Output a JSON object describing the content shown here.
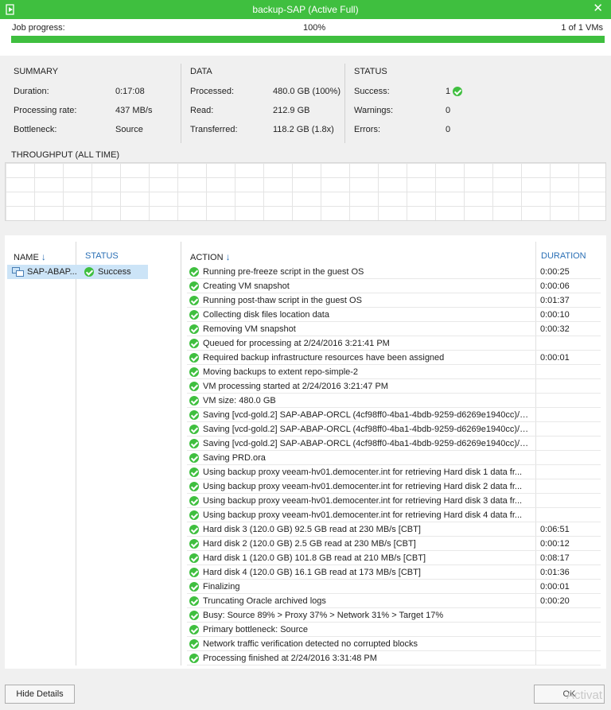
{
  "window": {
    "title": "backup-SAP (Active Full)",
    "close_glyph": "✕"
  },
  "job": {
    "progress_label": "Job progress:",
    "progress_text": "100%",
    "progress_fraction": 1.0,
    "vms_text": "1 of 1 VMs"
  },
  "summary": {
    "heading": "SUMMARY",
    "rows": [
      {
        "label": "Duration:",
        "value": "0:17:08"
      },
      {
        "label": "Processing rate:",
        "value": "437 MB/s"
      },
      {
        "label": "Bottleneck:",
        "value": "Source"
      }
    ]
  },
  "data_section": {
    "heading": "DATA",
    "rows": [
      {
        "label": "Processed:",
        "value": "480.0 GB (100%)"
      },
      {
        "label": "Read:",
        "value": "212.9 GB"
      },
      {
        "label": "Transferred:",
        "value": "118.2 GB (1.8x)"
      }
    ]
  },
  "status_section": {
    "heading": "STATUS",
    "rows": [
      {
        "label": "Success:",
        "value": "1"
      },
      {
        "label": "Warnings:",
        "value": "0"
      },
      {
        "label": "Errors:",
        "value": "0"
      }
    ]
  },
  "throughput": {
    "title": "THROUGHPUT (ALL TIME)"
  },
  "vm_list": {
    "name_header": "NAME",
    "status_header": "STATUS",
    "items": [
      {
        "name": "SAP-ABAP...",
        "status": "Success"
      }
    ]
  },
  "action_list": {
    "action_header": "ACTION",
    "duration_header": "DURATION",
    "rows": [
      {
        "text": "Running pre-freeze script in the guest OS",
        "duration": "0:00:25"
      },
      {
        "text": "Creating VM snapshot",
        "duration": "0:00:06"
      },
      {
        "text": "Running post-thaw script in the guest OS",
        "duration": "0:01:37"
      },
      {
        "text": "Collecting disk files location data",
        "duration": "0:00:10"
      },
      {
        "text": "Removing VM snapshot",
        "duration": "0:00:32"
      },
      {
        "text": "Queued for processing at 2/24/2016 3:21:41 PM",
        "duration": ""
      },
      {
        "text": "Required backup infrastructure resources have been assigned",
        "duration": "0:00:01"
      },
      {
        "text": "Moving backups to extent repo-simple-2",
        "duration": ""
      },
      {
        "text": "VM processing started at 2/24/2016 3:21:47 PM",
        "duration": ""
      },
      {
        "text": "VM size: 480.0 GB",
        "duration": ""
      },
      {
        "text": "Saving [vcd-gold.2] SAP-ABAP-ORCL (4cf98ff0-4ba1-4bdb-9259-d6269e1940cc)/S...",
        "duration": ""
      },
      {
        "text": "Saving [vcd-gold.2] SAP-ABAP-ORCL (4cf98ff0-4ba1-4bdb-9259-d6269e1940cc)/S...",
        "duration": ""
      },
      {
        "text": "Saving [vcd-gold.2] SAP-ABAP-ORCL (4cf98ff0-4ba1-4bdb-9259-d6269e1940cc)/S...",
        "duration": ""
      },
      {
        "text": "Saving PRD.ora",
        "duration": ""
      },
      {
        "text": "Using backup proxy veeam-hv01.democenter.int for retrieving Hard disk 1 data fr...",
        "duration": ""
      },
      {
        "text": "Using backup proxy veeam-hv01.democenter.int for retrieving Hard disk 2 data fr...",
        "duration": ""
      },
      {
        "text": "Using backup proxy veeam-hv01.democenter.int for retrieving Hard disk 3 data fr...",
        "duration": ""
      },
      {
        "text": "Using backup proxy veeam-hv01.democenter.int for retrieving Hard disk 4 data fr...",
        "duration": ""
      },
      {
        "text": "Hard disk 3 (120.0 GB) 92.5 GB read at 230 MB/s [CBT]",
        "duration": "0:06:51"
      },
      {
        "text": "Hard disk 2 (120.0 GB) 2.5 GB read at 230 MB/s [CBT]",
        "duration": "0:00:12"
      },
      {
        "text": "Hard disk 1 (120.0 GB) 101.8 GB read at 210 MB/s [CBT]",
        "duration": "0:08:17"
      },
      {
        "text": "Hard disk 4 (120.0 GB) 16.1 GB read at 173 MB/s [CBT]",
        "duration": "0:01:36"
      },
      {
        "text": "Finalizing",
        "duration": "0:00:01"
      },
      {
        "text": "Truncating Oracle archived logs",
        "duration": "0:00:20"
      },
      {
        "text": "Busy: Source 89% > Proxy 37% > Network 31% > Target 17%",
        "duration": ""
      },
      {
        "text": "Primary bottleneck: Source",
        "duration": ""
      },
      {
        "text": "Network traffic verification detected no corrupted blocks",
        "duration": ""
      },
      {
        "text": "Processing finished at 2/24/2016 3:31:48 PM",
        "duration": ""
      }
    ]
  },
  "footer": {
    "hide_details_label": "Hide Details",
    "ok_label": "OK",
    "watermark": "Activat"
  },
  "colors": {
    "accent_green": "#3fbf3f",
    "header_blue": "#2a6fb5",
    "selection_blue": "#cce4f7"
  }
}
